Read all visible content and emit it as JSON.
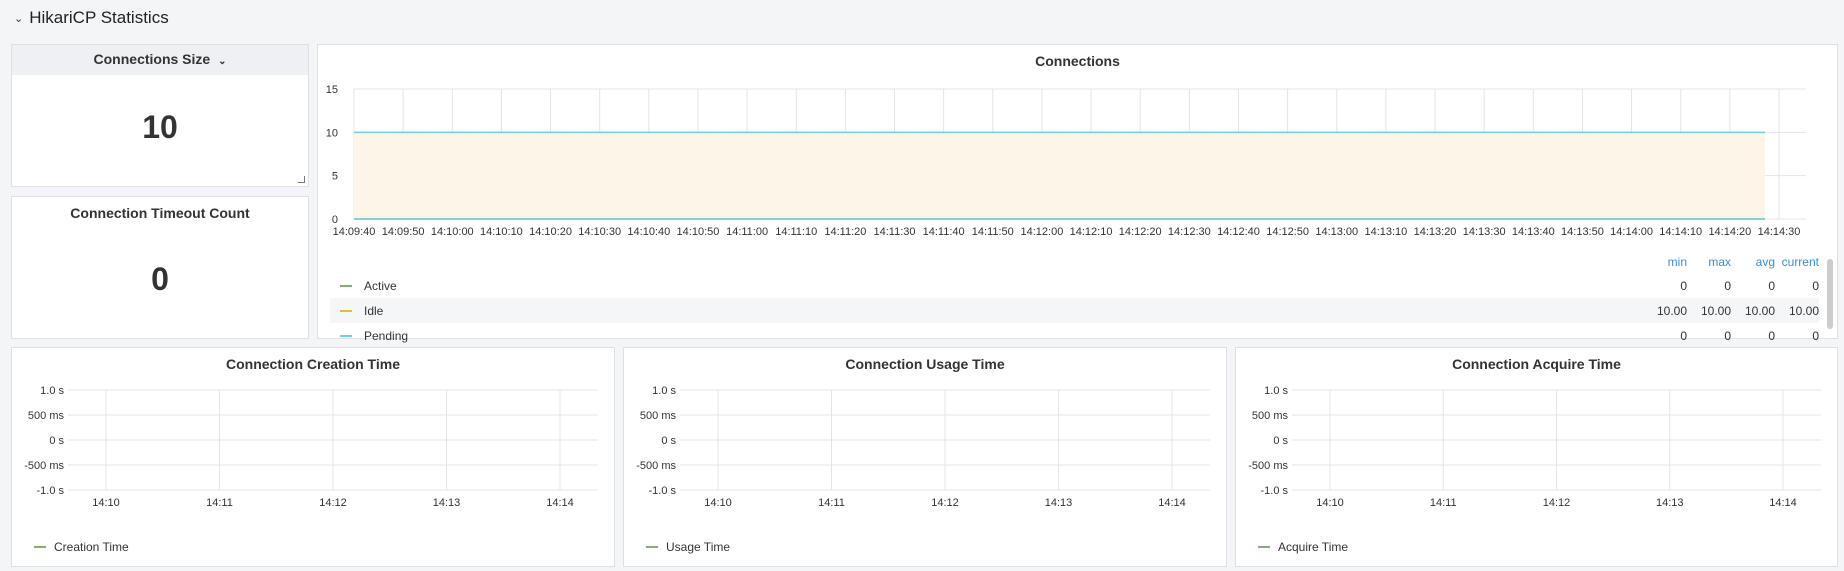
{
  "row": {
    "title": "HikariCP Statistics",
    "chevron": "⌄"
  },
  "stats": {
    "size": {
      "title": "Connections Size",
      "value": "10"
    },
    "timeout": {
      "title": "Connection Timeout Count",
      "value": "0"
    }
  },
  "connections": {
    "title": "Connections",
    "y_ticks": [
      "15",
      "10",
      "5",
      "0"
    ],
    "x_ticks": [
      "14:09:40",
      "14:09:50",
      "14:10:00",
      "14:10:10",
      "14:10:20",
      "14:10:30",
      "14:10:40",
      "14:10:50",
      "14:11:00",
      "14:11:10",
      "14:11:20",
      "14:11:30",
      "14:11:40",
      "14:11:50",
      "14:12:00",
      "14:12:10",
      "14:12:20",
      "14:12:30",
      "14:12:40",
      "14:12:50",
      "14:13:00",
      "14:13:10",
      "14:13:20",
      "14:13:30",
      "14:13:40",
      "14:13:50",
      "14:14:00",
      "14:14:10",
      "14:14:20",
      "14:14:30"
    ],
    "legend_headers": {
      "min": "min",
      "max": "max",
      "avg": "avg",
      "current": "current"
    },
    "legend": [
      {
        "name": "Active",
        "color": "#7eb26d",
        "min": "0",
        "max": "0",
        "avg": "0",
        "current": "0"
      },
      {
        "name": "Idle",
        "color": "#eab839",
        "min": "10.00",
        "max": "10.00",
        "avg": "10.00",
        "current": "10.00"
      },
      {
        "name": "Pending",
        "color": "#6ed0e0",
        "min": "0",
        "max": "0",
        "avg": "0",
        "current": "0"
      }
    ]
  },
  "chart_data": [
    {
      "type": "area",
      "title": "Connections",
      "x": [
        "14:09:40",
        "14:14:30"
      ],
      "ylim": [
        0,
        15
      ],
      "series": [
        {
          "name": "Active",
          "values": [
            0,
            0
          ]
        },
        {
          "name": "Idle",
          "values": [
            10,
            10
          ]
        },
        {
          "name": "Pending",
          "values": [
            0,
            0
          ]
        }
      ]
    },
    {
      "type": "line",
      "title": "Connection Creation Time",
      "categories": [
        "14:10",
        "14:11",
        "14:12",
        "14:13",
        "14:14"
      ],
      "ylim": [
        -1.0,
        1.0
      ],
      "series": [
        {
          "name": "Creation Time",
          "values": []
        }
      ]
    },
    {
      "type": "line",
      "title": "Connection Usage Time",
      "categories": [
        "14:10",
        "14:11",
        "14:12",
        "14:13",
        "14:14"
      ],
      "ylim": [
        -1.0,
        1.0
      ],
      "series": [
        {
          "name": "Usage Time",
          "values": []
        }
      ]
    },
    {
      "type": "line",
      "title": "Connection Acquire Time",
      "categories": [
        "14:10",
        "14:11",
        "14:12",
        "14:13",
        "14:14"
      ],
      "ylim": [
        -1.0,
        1.0
      ],
      "series": [
        {
          "name": "Acquire Time",
          "values": []
        }
      ]
    }
  ],
  "time_panels": [
    {
      "title": "Connection Creation Time",
      "legend": "Creation Time",
      "color": "#7eb26d"
    },
    {
      "title": "Connection Usage Time",
      "legend": "Usage Time",
      "color": "#7eb26d"
    },
    {
      "title": "Connection Acquire Time",
      "legend": "Acquire Time",
      "color": "#7eb26d"
    }
  ],
  "time_y_ticks": [
    "1.0 s",
    "500 ms",
    "0 s",
    "-500 ms",
    "-1.0 s"
  ],
  "time_x_ticks": [
    "14:10",
    "14:11",
    "14:12",
    "14:13",
    "14:14"
  ]
}
